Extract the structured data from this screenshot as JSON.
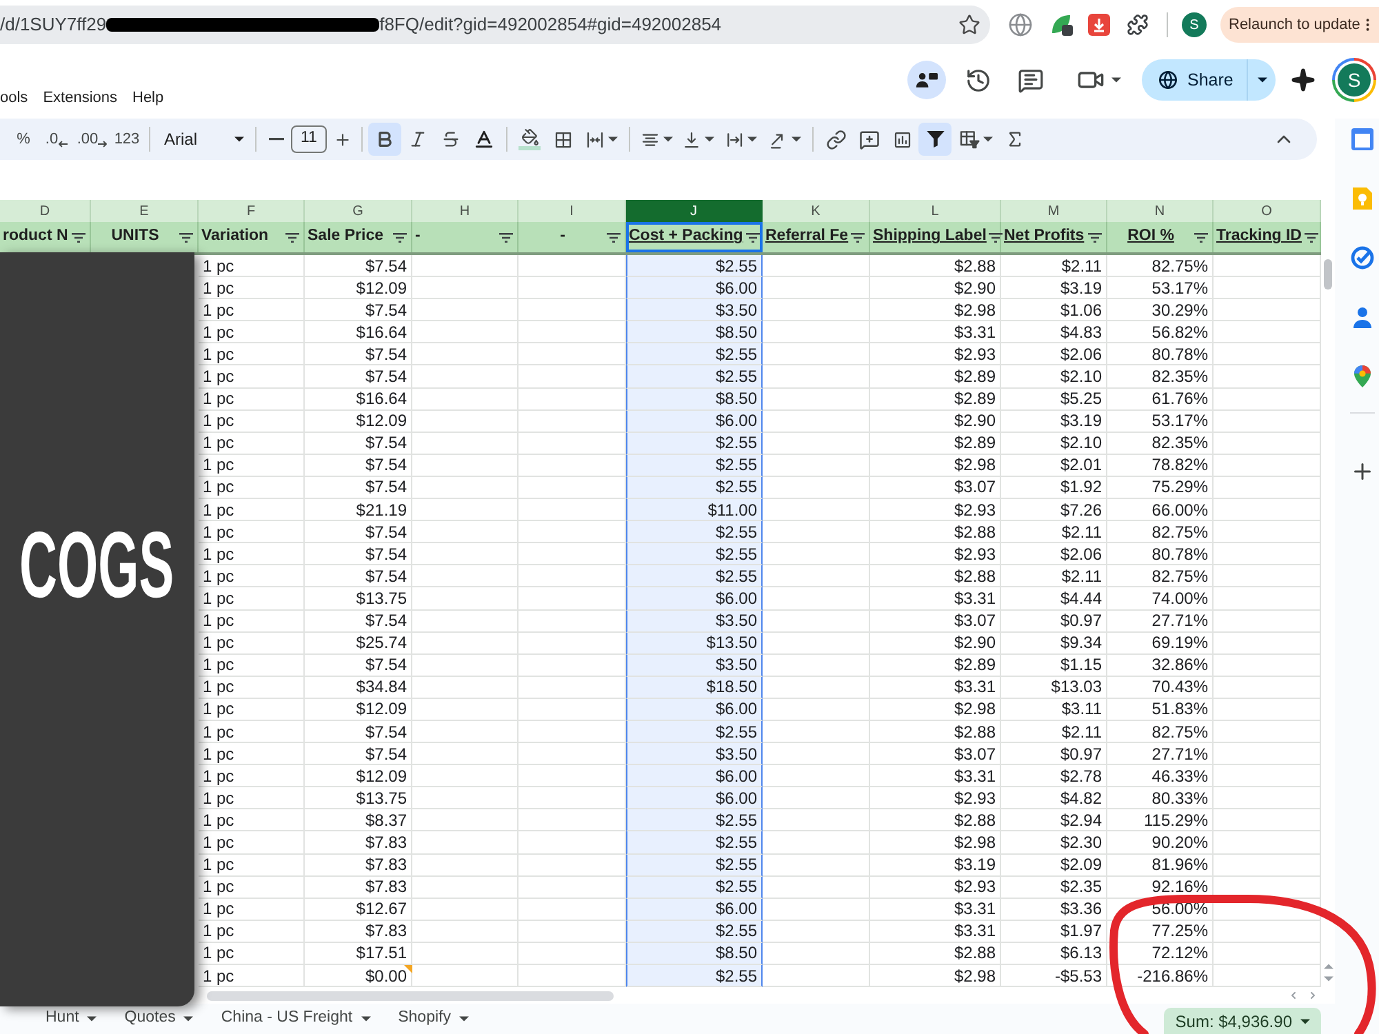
{
  "browser": {
    "url_start": "/d/1SUY7ff29",
    "url_end": "f8FQ/edit?gid=492002854#gid=492002854",
    "profile_initial": "S",
    "relaunch_label": "Relaunch to update"
  },
  "menu": [
    "ools",
    "Extensions",
    "Help"
  ],
  "header_actions": {
    "share_label": "Share",
    "account_initial": "S"
  },
  "toolbar": {
    "number_formats": [
      "%",
      ".0",
      ".00",
      "123"
    ],
    "font": "Arial",
    "font_size": "11",
    "style_toggles": [
      {
        "on": true
      },
      {
        "on": false
      },
      {
        "on": false
      }
    ],
    "filter": {
      "on": true
    }
  },
  "columns": [
    {
      "letter": "D",
      "header": "roduct N",
      "selected": false
    },
    {
      "letter": "E",
      "header": "UNITS",
      "selected": false
    },
    {
      "letter": "F",
      "header": "Variation",
      "selected": false
    },
    {
      "letter": "G",
      "header": "Sale Price",
      "selected": false
    },
    {
      "letter": "H",
      "header": "-",
      "selected": false
    },
    {
      "letter": "I",
      "header": "-",
      "selected": false
    },
    {
      "letter": "J",
      "header": "Cost + Packing",
      "selected": true
    },
    {
      "letter": "K",
      "header": "Referral Fe",
      "selected": false
    },
    {
      "letter": "L",
      "header": "Shipping Label",
      "selected": false
    },
    {
      "letter": "M",
      "header": "Net Profits",
      "selected": false
    },
    {
      "letter": "N",
      "header": "ROI %",
      "selected": false
    },
    {
      "letter": "O",
      "header": "Tracking ID",
      "selected": false
    }
  ],
  "rows": [
    {
      "variation": "1 pc",
      "sale_price": "$7.54",
      "cost_packing": "$2.55",
      "shipping_label": "$2.88",
      "net_profits": "$2.11",
      "roi": "82.75%",
      "note": false
    },
    {
      "variation": "1 pc",
      "sale_price": "$12.09",
      "cost_packing": "$6.00",
      "shipping_label": "$2.90",
      "net_profits": "$3.19",
      "roi": "53.17%",
      "note": false
    },
    {
      "variation": "1 pc",
      "sale_price": "$7.54",
      "cost_packing": "$3.50",
      "shipping_label": "$2.98",
      "net_profits": "$1.06",
      "roi": "30.29%",
      "note": false
    },
    {
      "variation": "1 pc",
      "sale_price": "$16.64",
      "cost_packing": "$8.50",
      "shipping_label": "$3.31",
      "net_profits": "$4.83",
      "roi": "56.82%",
      "note": false
    },
    {
      "variation": "1 pc",
      "sale_price": "$7.54",
      "cost_packing": "$2.55",
      "shipping_label": "$2.93",
      "net_profits": "$2.06",
      "roi": "80.78%",
      "note": false
    },
    {
      "variation": "1 pc",
      "sale_price": "$7.54",
      "cost_packing": "$2.55",
      "shipping_label": "$2.89",
      "net_profits": "$2.10",
      "roi": "82.35%",
      "note": false
    },
    {
      "variation": "1 pc",
      "sale_price": "$16.64",
      "cost_packing": "$8.50",
      "shipping_label": "$2.89",
      "net_profits": "$5.25",
      "roi": "61.76%",
      "note": false
    },
    {
      "variation": "1 pc",
      "sale_price": "$12.09",
      "cost_packing": "$6.00",
      "shipping_label": "$2.90",
      "net_profits": "$3.19",
      "roi": "53.17%",
      "note": false
    },
    {
      "variation": "1 pc",
      "sale_price": "$7.54",
      "cost_packing": "$2.55",
      "shipping_label": "$2.89",
      "net_profits": "$2.10",
      "roi": "82.35%",
      "note": false
    },
    {
      "variation": "1 pc",
      "sale_price": "$7.54",
      "cost_packing": "$2.55",
      "shipping_label": "$2.98",
      "net_profits": "$2.01",
      "roi": "78.82%",
      "note": false
    },
    {
      "variation": "1 pc",
      "sale_price": "$7.54",
      "cost_packing": "$2.55",
      "shipping_label": "$3.07",
      "net_profits": "$1.92",
      "roi": "75.29%",
      "note": false
    },
    {
      "variation": "1 pc",
      "sale_price": "$21.19",
      "cost_packing": "$11.00",
      "shipping_label": "$2.93",
      "net_profits": "$7.26",
      "roi": "66.00%",
      "note": false
    },
    {
      "variation": "1 pc",
      "sale_price": "$7.54",
      "cost_packing": "$2.55",
      "shipping_label": "$2.88",
      "net_profits": "$2.11",
      "roi": "82.75%",
      "note": false
    },
    {
      "variation": "1 pc",
      "sale_price": "$7.54",
      "cost_packing": "$2.55",
      "shipping_label": "$2.93",
      "net_profits": "$2.06",
      "roi": "80.78%",
      "note": false
    },
    {
      "variation": "1 pc",
      "sale_price": "$7.54",
      "cost_packing": "$2.55",
      "shipping_label": "$2.88",
      "net_profits": "$2.11",
      "roi": "82.75%",
      "note": false
    },
    {
      "variation": "1 pc",
      "sale_price": "$13.75",
      "cost_packing": "$6.00",
      "shipping_label": "$3.31",
      "net_profits": "$4.44",
      "roi": "74.00%",
      "note": false
    },
    {
      "variation": "1 pc",
      "sale_price": "$7.54",
      "cost_packing": "$3.50",
      "shipping_label": "$3.07",
      "net_profits": "$0.97",
      "roi": "27.71%",
      "note": false
    },
    {
      "variation": "1 pc",
      "sale_price": "$25.74",
      "cost_packing": "$13.50",
      "shipping_label": "$2.90",
      "net_profits": "$9.34",
      "roi": "69.19%",
      "note": false
    },
    {
      "variation": "1 pc",
      "sale_price": "$7.54",
      "cost_packing": "$3.50",
      "shipping_label": "$2.89",
      "net_profits": "$1.15",
      "roi": "32.86%",
      "note": false
    },
    {
      "variation": "1 pc",
      "sale_price": "$34.84",
      "cost_packing": "$18.50",
      "shipping_label": "$3.31",
      "net_profits": "$13.03",
      "roi": "70.43%",
      "note": false
    },
    {
      "variation": "1 pc",
      "sale_price": "$12.09",
      "cost_packing": "$6.00",
      "shipping_label": "$2.98",
      "net_profits": "$3.11",
      "roi": "51.83%",
      "note": false
    },
    {
      "variation": "1 pc",
      "sale_price": "$7.54",
      "cost_packing": "$2.55",
      "shipping_label": "$2.88",
      "net_profits": "$2.11",
      "roi": "82.75%",
      "note": false
    },
    {
      "variation": "1 pc",
      "sale_price": "$7.54",
      "cost_packing": "$3.50",
      "shipping_label": "$3.07",
      "net_profits": "$0.97",
      "roi": "27.71%",
      "note": false
    },
    {
      "variation": "1 pc",
      "sale_price": "$12.09",
      "cost_packing": "$6.00",
      "shipping_label": "$3.31",
      "net_profits": "$2.78",
      "roi": "46.33%",
      "note": false
    },
    {
      "variation": "1 pc",
      "sale_price": "$13.75",
      "cost_packing": "$6.00",
      "shipping_label": "$2.93",
      "net_profits": "$4.82",
      "roi": "80.33%",
      "note": false
    },
    {
      "variation": "1 pc",
      "sale_price": "$8.37",
      "cost_packing": "$2.55",
      "shipping_label": "$2.88",
      "net_profits": "$2.94",
      "roi": "115.29%",
      "note": false
    },
    {
      "variation": "1 pc",
      "sale_price": "$7.83",
      "cost_packing": "$2.55",
      "shipping_label": "$2.98",
      "net_profits": "$2.30",
      "roi": "90.20%",
      "note": false
    },
    {
      "variation": "1 pc",
      "sale_price": "$7.83",
      "cost_packing": "$2.55",
      "shipping_label": "$3.19",
      "net_profits": "$2.09",
      "roi": "81.96%",
      "note": false
    },
    {
      "variation": "1 pc",
      "sale_price": "$7.83",
      "cost_packing": "$2.55",
      "shipping_label": "$2.93",
      "net_profits": "$2.35",
      "roi": "92.16%",
      "note": false
    },
    {
      "variation": "1 pc",
      "sale_price": "$12.67",
      "cost_packing": "$6.00",
      "shipping_label": "$3.31",
      "net_profits": "$3.36",
      "roi": "56.00%",
      "note": false
    },
    {
      "variation": "1 pc",
      "sale_price": "$7.83",
      "cost_packing": "$2.55",
      "shipping_label": "$3.31",
      "net_profits": "$1.97",
      "roi": "77.25%",
      "note": false
    },
    {
      "variation": "1 pc",
      "sale_price": "$17.51",
      "cost_packing": "$8.50",
      "shipping_label": "$2.88",
      "net_profits": "$6.13",
      "roi": "72.12%",
      "note": false
    },
    {
      "variation": "1 pc",
      "sale_price": "$0.00",
      "cost_packing": "$2.55",
      "shipping_label": "$2.98",
      "net_profits": "-$5.53",
      "roi": "-216.86%",
      "note": true
    }
  ],
  "sheet_tabs": [
    {
      "label": "Hunt",
      "selected": false
    },
    {
      "label": "Quotes",
      "selected": false
    },
    {
      "label": "China - US Freight",
      "selected": false
    },
    {
      "label": "Shopify",
      "selected": false
    }
  ],
  "status": {
    "sum": "Sum: $4,936.90"
  },
  "overlay": {
    "label": "COGS"
  }
}
